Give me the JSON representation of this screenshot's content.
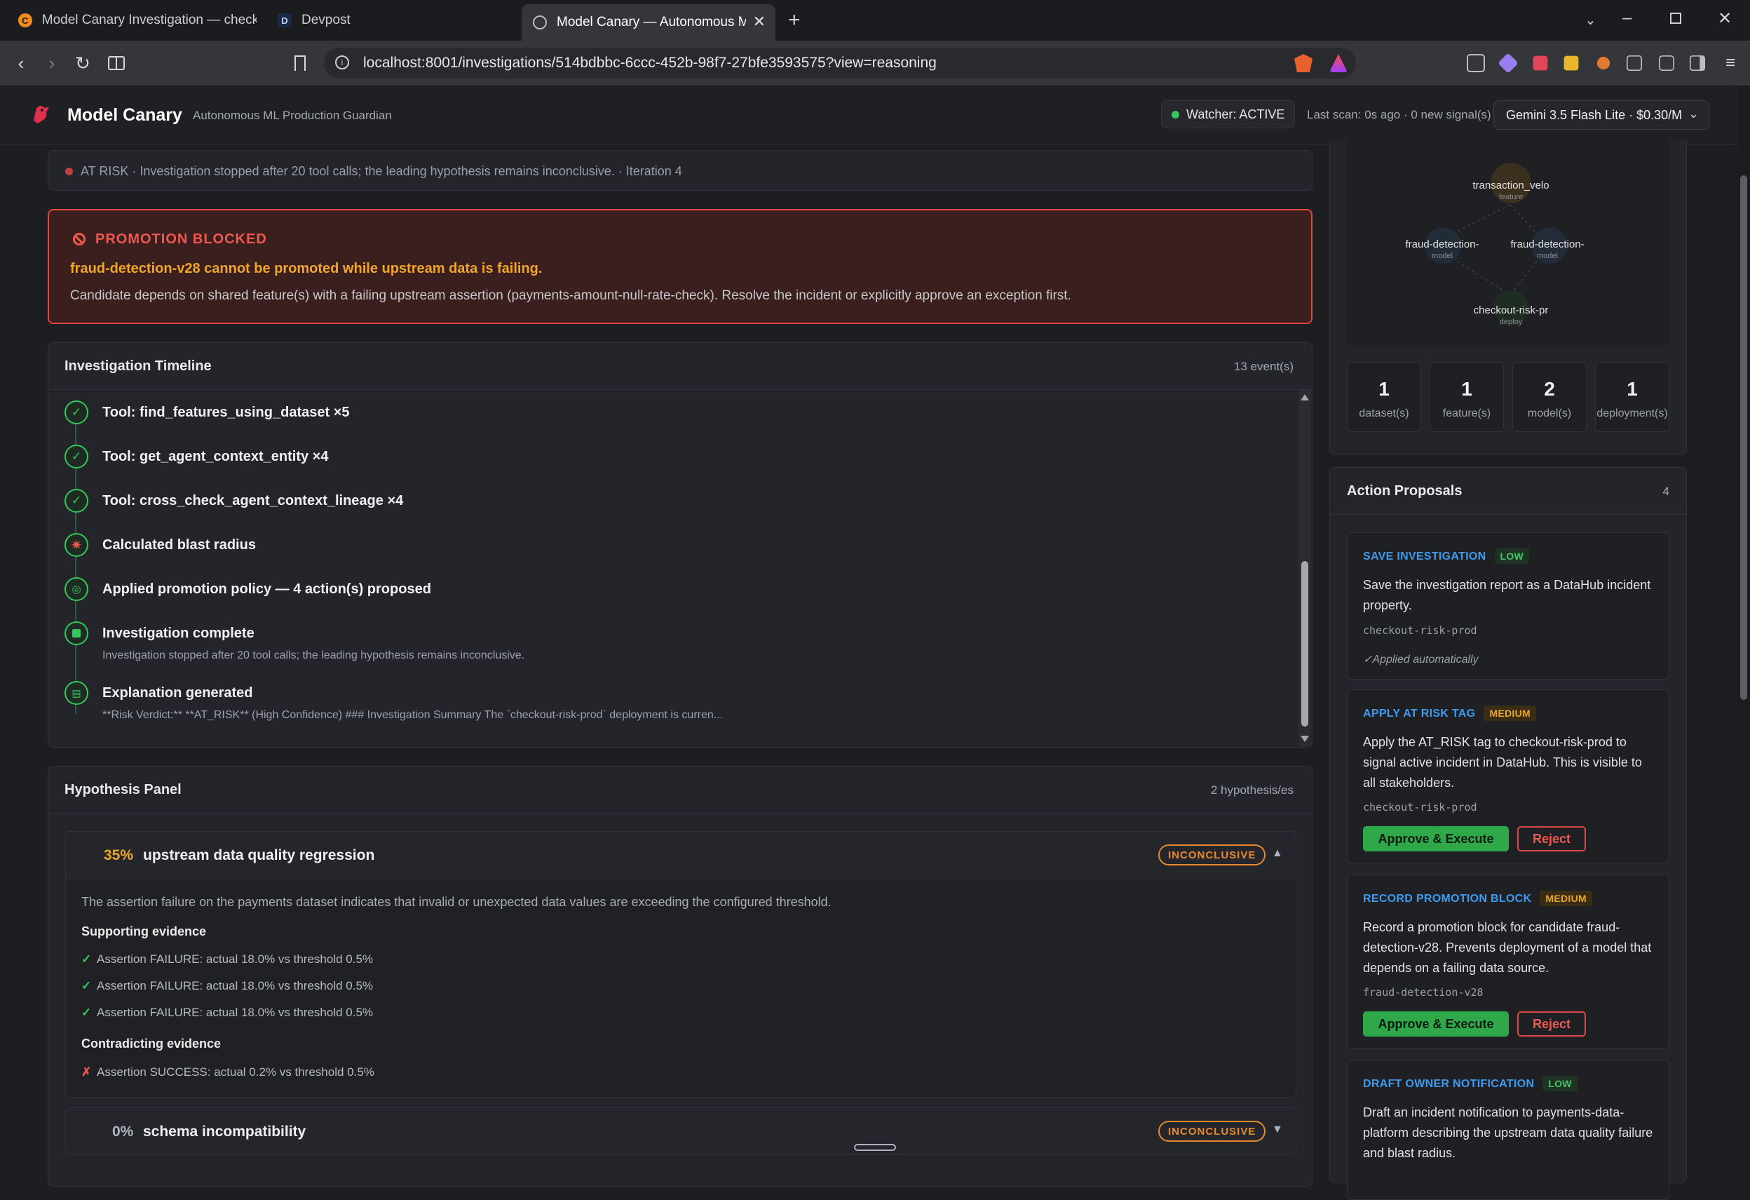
{
  "browser": {
    "tabs": [
      {
        "label": "Model Canary Investigation — check"
      },
      {
        "label": "Devpost"
      },
      {
        "label": "Model Canary — Autonomous M"
      }
    ],
    "url": "localhost:8001/investigations/514bdbbc-6ccc-452b-98f7-27bfe3593575?view=reasoning"
  },
  "header": {
    "brand": "Model Canary",
    "tagline": "Autonomous ML Production Guardian",
    "watcher": "Watcher: ACTIVE",
    "last_scan": "Last scan: 0s ago · 0 new signal(s)",
    "model": "Gemini 3.5 Flash Lite · $0.30/M"
  },
  "status": {
    "text": "AT RISK  · Investigation stopped after 20 tool calls; the leading hypothesis remains inconclusive.   · Iteration 4"
  },
  "blocked": {
    "title": "PROMOTION BLOCKED",
    "message": "fraud-detection-v28 cannot be promoted while upstream data is failing.",
    "description": "Candidate depends on shared feature(s) with a failing upstream assertion (payments-amount-null-rate-check). Resolve the incident or explicitly approve an exception first."
  },
  "timeline": {
    "title": "Investigation Timeline",
    "count": "13 event(s)",
    "items": [
      {
        "title": "Tool: find_features_using_dataset ×5",
        "sub": ""
      },
      {
        "title": "Tool: get_agent_context_entity ×4",
        "sub": ""
      },
      {
        "title": "Tool: cross_check_agent_context_lineage ×4",
        "sub": ""
      },
      {
        "title": "Calculated blast radius",
        "sub": ""
      },
      {
        "title": "Applied promotion policy — 4 action(s) proposed",
        "sub": ""
      },
      {
        "title": "Investigation complete",
        "sub": "Investigation stopped after 20 tool calls; the leading hypothesis remains inconclusive."
      },
      {
        "title": "Explanation generated",
        "sub": "**Risk Verdict:** **AT_RISK** (High Confidence) ### Investigation Summary The `checkout-risk-prod` deployment is curren..."
      }
    ]
  },
  "hypotheses": {
    "title": "Hypothesis Panel",
    "count": "2 hypothesis/es",
    "items": [
      {
        "pct": "35%",
        "name": "upstream data quality regression",
        "badge": "INCONCLUSIVE",
        "description": "The assertion failure on the payments dataset indicates that invalid or unexpected data values are exceeding the configured threshold.",
        "supporting_label": "Supporting evidence",
        "supporting": [
          "Assertion FAILURE: actual 18.0% vs threshold 0.5%",
          "Assertion FAILURE: actual 18.0% vs threshold 0.5%",
          "Assertion FAILURE: actual 18.0% vs threshold 0.5%"
        ],
        "contradicting_label": "Contradicting evidence",
        "contradicting": [
          "Assertion SUCCESS: actual 0.2% vs threshold 0.5%"
        ]
      },
      {
        "pct": "0%",
        "name": "schema incompatibility",
        "badge": "INCONCLUSIVE"
      }
    ]
  },
  "graph": {
    "nodes": [
      {
        "label": "transaction_velo",
        "type": "feature"
      },
      {
        "label": "fraud-detection-",
        "type": "model"
      },
      {
        "label": "fraud-detection-",
        "type": "model"
      },
      {
        "label": "checkout-risk-pr",
        "type": "deploy"
      }
    ]
  },
  "stats": [
    {
      "num": "1",
      "label": "dataset(s)"
    },
    {
      "num": "1",
      "label": "feature(s)"
    },
    {
      "num": "2",
      "label": "model(s)"
    },
    {
      "num": "1",
      "label": "deployment(s)"
    }
  ],
  "actions": {
    "title": "Action Proposals",
    "count": "4",
    "approve_label": "Approve & Execute",
    "reject_label": "Reject",
    "items": [
      {
        "title": "SAVE INVESTIGATION",
        "severity": "LOW",
        "description": "Save the investigation report as a DataHub incident property.",
        "entity": "checkout-risk-prod",
        "applied": "✓Applied automatically"
      },
      {
        "title": "APPLY AT RISK TAG",
        "severity": "MEDIUM",
        "description": "Apply the AT_RISK tag to checkout-risk-prod to signal active incident in DataHub. This is visible to all stakeholders.",
        "entity": "checkout-risk-prod"
      },
      {
        "title": "RECORD PROMOTION BLOCK",
        "severity": "MEDIUM",
        "description": "Record a promotion block for candidate fraud-detection-v28. Prevents deployment of a model that depends on a failing data source.",
        "entity": "fraud-detection-v28"
      },
      {
        "title": "DRAFT OWNER NOTIFICATION",
        "severity": "LOW",
        "description": "Draft an incident notification to payments-data-platform describing the upstream data quality failure and blast radius."
      }
    ]
  },
  "colors": {
    "accent_green": "#34c759",
    "danger": "#f0574f",
    "warning": "#f0a62b",
    "link_blue": "#3f9bf0"
  }
}
